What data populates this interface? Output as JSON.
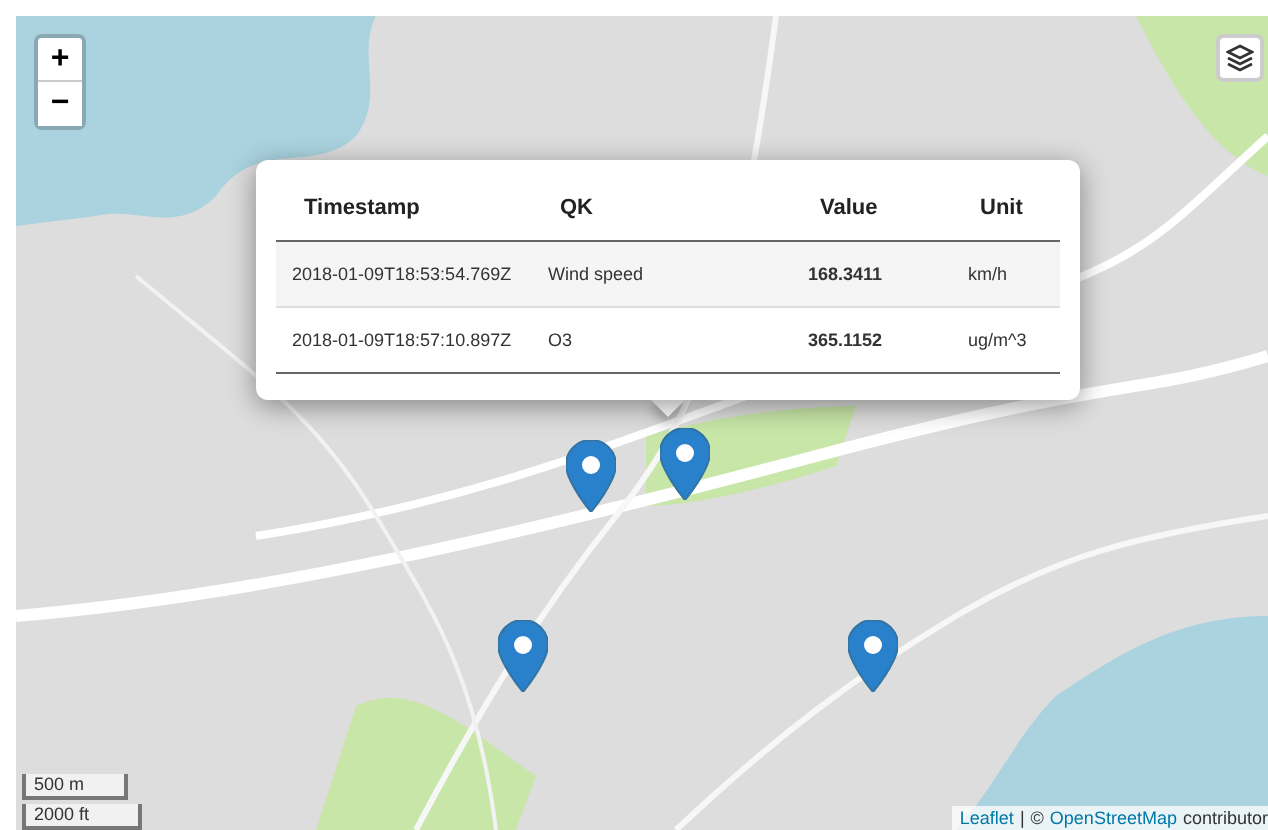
{
  "map": {
    "zoom_in": "+",
    "zoom_out": "−"
  },
  "popup": {
    "columns": [
      "Timestamp",
      "QK",
      "Value",
      "Unit"
    ],
    "rows": [
      {
        "timestamp": "2018-01-09T18:53:54.769Z",
        "qk": "Wind speed",
        "value": "168.3411",
        "unit": "km/h"
      },
      {
        "timestamp": "2018-01-09T18:57:10.897Z",
        "qk": "O3",
        "value": "365.1152",
        "unit": "ug/m^3"
      }
    ]
  },
  "scale": [
    "500 m",
    "2000 ft"
  ],
  "attribution": {
    "leaflet": "Leaflet",
    "separator": "|",
    "copyright": "©",
    "osm": "OpenStreetMap",
    "rest": "contributor"
  }
}
